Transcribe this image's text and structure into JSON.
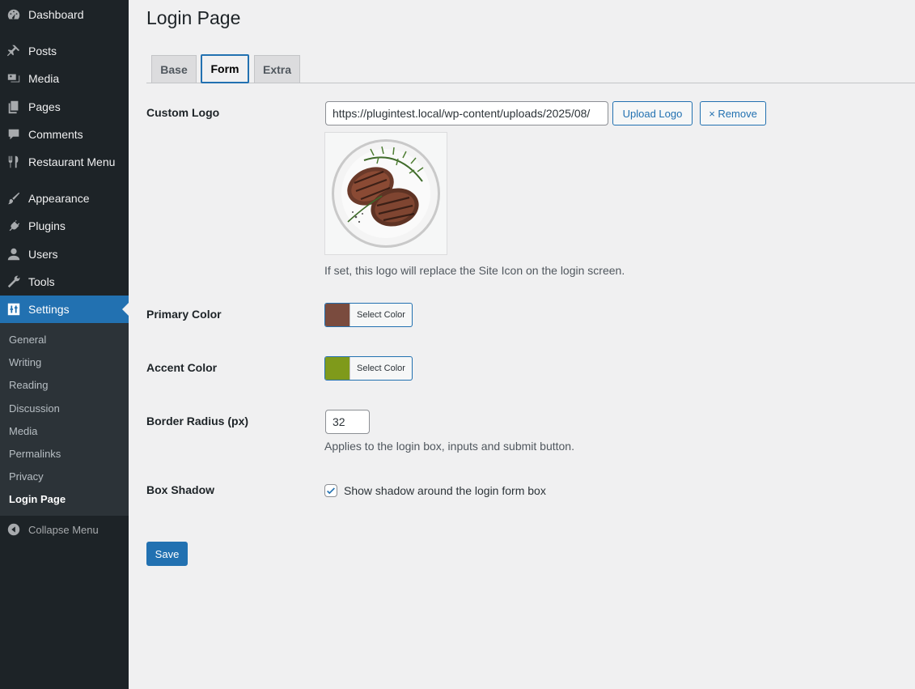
{
  "sidebar": {
    "items": [
      {
        "label": "Dashboard",
        "icon": "dashboard-icon"
      },
      {
        "label": "Posts",
        "icon": "pin-icon"
      },
      {
        "label": "Media",
        "icon": "media-icon"
      },
      {
        "label": "Pages",
        "icon": "pages-icon"
      },
      {
        "label": "Comments",
        "icon": "comment-icon"
      },
      {
        "label": "Restaurant Menu",
        "icon": "utensils-icon"
      },
      {
        "label": "Appearance",
        "icon": "brush-icon"
      },
      {
        "label": "Plugins",
        "icon": "plug-icon"
      },
      {
        "label": "Users",
        "icon": "user-icon"
      },
      {
        "label": "Tools",
        "icon": "wrench-icon"
      },
      {
        "label": "Settings",
        "icon": "settings-icon",
        "active": true
      }
    ],
    "submenu": [
      "General",
      "Writing",
      "Reading",
      "Discussion",
      "Media",
      "Permalinks",
      "Privacy",
      "Login Page"
    ],
    "current_submenu": "Login Page",
    "collapse_label": "Collapse Menu"
  },
  "page": {
    "title": "Login Page",
    "tabs": [
      "Base",
      "Form",
      "Extra"
    ],
    "active_tab": "Form"
  },
  "form": {
    "custom_logo": {
      "label": "Custom Logo",
      "value": "https://plugintest.local/wp-content/uploads/2025/08/",
      "upload_label": "Upload Logo",
      "remove_label": "× Remove",
      "description": "If set, this logo will replace the Site Icon on the login screen."
    },
    "primary_color": {
      "label": "Primary Color",
      "button_label": "Select Color",
      "color": "#7a4b3e"
    },
    "accent_color": {
      "label": "Accent Color",
      "button_label": "Select Color",
      "color": "#7f9a1b"
    },
    "border_radius": {
      "label": "Border Radius (px)",
      "value": "32",
      "description": "Applies to the login box, inputs and submit button."
    },
    "box_shadow": {
      "label": "Box Shadow",
      "checked": true,
      "checkbox_label": "Show shadow around the login form box"
    },
    "save_label": "Save"
  },
  "colors": {
    "admin_blue": "#2271b1",
    "sidebar_bg": "#1d2327",
    "submenu_bg": "#2c3338"
  }
}
